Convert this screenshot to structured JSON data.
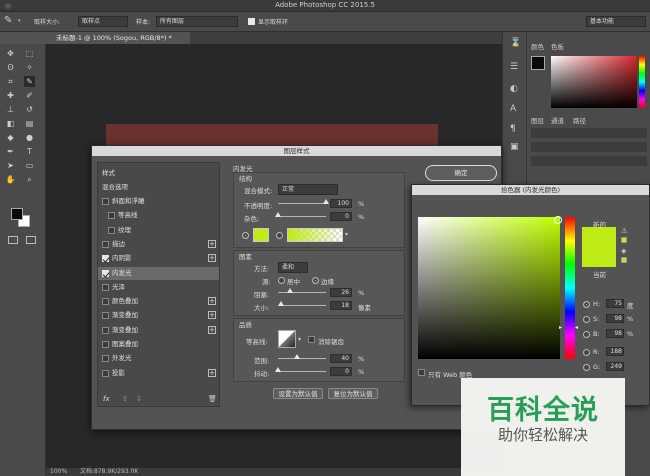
{
  "app": {
    "title": "Adobe Photoshop CC 2015.5"
  },
  "options_bar": {
    "sample_size_label": "取样大小:",
    "sample_size_value": "取样点",
    "sample_label": "样本:",
    "sample_value": "所有图层",
    "show_ring_label": "显示取样环",
    "workspace": "基本功能"
  },
  "document": {
    "tab_label": "未标题-1 @ 100% (Sogou, RGB/8*) *",
    "zoom": "100%",
    "doc_info": "文档:878.9K/293.0K"
  },
  "right_panel": {
    "color_tab": "颜色",
    "swatches_tab": "色板",
    "layers_tab": "图层",
    "channels_tab": "通道",
    "paths_tab": "路径"
  },
  "layer_style": {
    "title": "图层样式",
    "styles_header": "样式",
    "blending_options": "混合选项",
    "items": [
      {
        "label": "斜面和浮雕",
        "checked": false,
        "plus": false,
        "indent": false
      },
      {
        "label": "等高线",
        "checked": false,
        "plus": false,
        "indent": true
      },
      {
        "label": "纹理",
        "checked": false,
        "plus": false,
        "indent": true
      },
      {
        "label": "描边",
        "checked": false,
        "plus": true,
        "indent": false
      },
      {
        "label": "内阴影",
        "checked": true,
        "plus": true,
        "indent": false
      },
      {
        "label": "内发光",
        "checked": true,
        "plus": false,
        "indent": false,
        "selected": true
      },
      {
        "label": "光泽",
        "checked": false,
        "plus": false,
        "indent": false
      },
      {
        "label": "颜色叠加",
        "checked": false,
        "plus": true,
        "indent": false
      },
      {
        "label": "渐变叠加",
        "checked": false,
        "plus": true,
        "indent": false
      },
      {
        "label": "渐变叠加",
        "checked": false,
        "plus": true,
        "indent": false
      },
      {
        "label": "图案叠加",
        "checked": false,
        "plus": false,
        "indent": false
      },
      {
        "label": "外发光",
        "checked": false,
        "plus": false,
        "indent": false
      },
      {
        "label": "投影",
        "checked": false,
        "plus": true,
        "indent": false
      }
    ],
    "fx_label": "fx",
    "panel_title": "内发光",
    "structure": {
      "header": "结构",
      "blend_mode_label": "混合模式:",
      "blend_mode_value": "正常",
      "opacity_label": "不透明度:",
      "opacity_value": "100",
      "noise_label": "杂色:",
      "noise_value": "0",
      "pct": "%",
      "opacity_fraction": 1.0,
      "noise_fraction": 0.0
    },
    "elements": {
      "header": "图素",
      "method_label": "方法:",
      "method_value": "柔和",
      "source_label": "源:",
      "center_label": "居中",
      "edge_label": "边缘",
      "choke_label": "阻塞:",
      "choke_value": "26",
      "size_label": "大小:",
      "size_value": "18",
      "pct": "%",
      "px": "像素",
      "choke_fraction": 0.26,
      "size_fraction": 0.07
    },
    "quality": {
      "header": "品质",
      "contour_label": "等高线:",
      "antialias_label": "消除锯齿",
      "range_label": "范围:",
      "range_value": "40",
      "jitter_label": "抖动:",
      "jitter_value": "0",
      "pct": "%",
      "range_fraction": 0.4,
      "jitter_fraction": 0.0
    },
    "set_default": "设置为默认值",
    "reset_default": "复位为默认值",
    "ok_button": "确定"
  },
  "color_picker": {
    "title": "拾色器 (内发光颜色)",
    "new_label": "新的",
    "current_label": "当前",
    "web_only_label": "只有 Web 颜色",
    "color": "#bfeb16",
    "H_label": "H:",
    "H_value": "75",
    "H_unit": "度",
    "S_label": "S:",
    "S_value": "98",
    "S_unit": "%",
    "B_label": "B:",
    "B_value": "98",
    "B_unit": "%",
    "R_label": "R:",
    "R_value": "188",
    "G_label": "G:",
    "G_value": "249"
  },
  "watermark": {
    "line1": "百科全说",
    "line2": "助你轻松解决"
  }
}
